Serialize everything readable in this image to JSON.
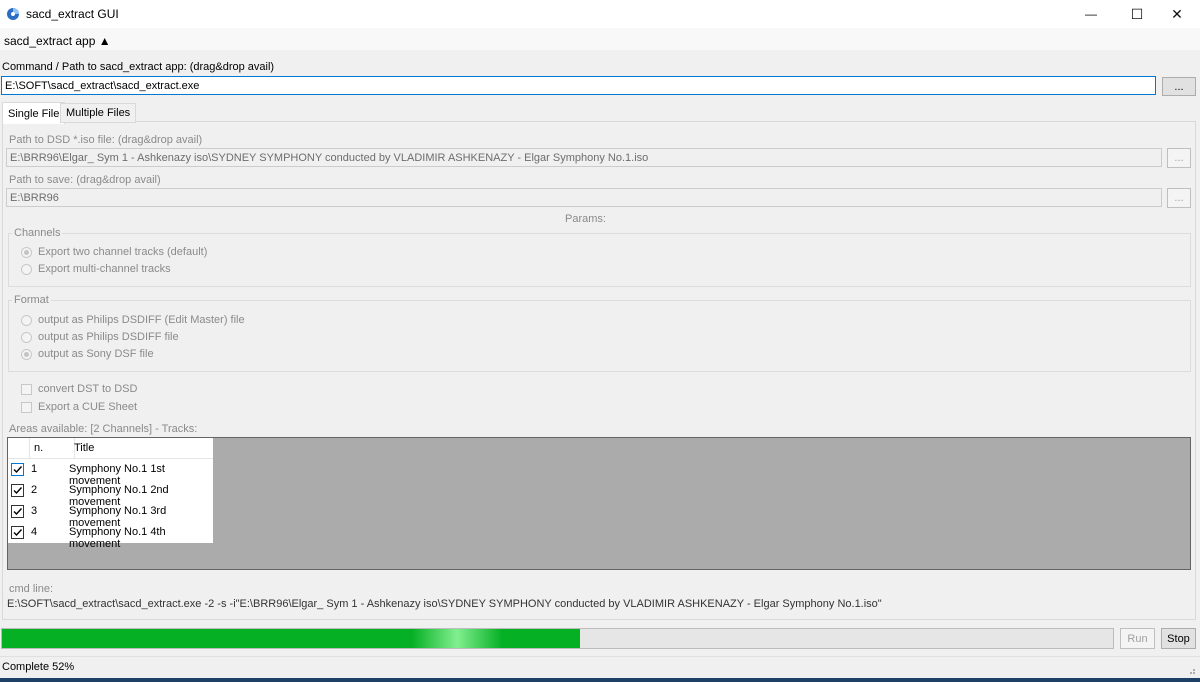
{
  "window": {
    "title": "sacd_extract GUI",
    "minimize_glyph": "—",
    "maximize_glyph": "☐",
    "close_glyph": "✕"
  },
  "menu": {
    "app_title": "sacd_extract app ▲"
  },
  "command": {
    "label": "Command / Path to sacd_extract app: (drag&drop avail)",
    "value": "E:\\SOFT\\sacd_extract\\sacd_extract.exe",
    "browse_label": "..."
  },
  "tabs": [
    {
      "label": "Single File",
      "active": true
    },
    {
      "label": "Multiple Files",
      "active": false
    }
  ],
  "single": {
    "iso_label": "Path to DSD *.iso file: (drag&drop avail)",
    "iso_value": "E:\\BRR96\\Elgar_ Sym 1 - Ashkenazy iso\\SYDNEY SYMPHONY conducted by VLADIMIR ASHKENAZY - Elgar Symphony No.1.iso",
    "iso_browse": "...",
    "save_label": "Path to save: (drag&drop avail)",
    "save_value": "E:\\BRR96",
    "save_browse": "...",
    "params_label": "Params:",
    "channels": {
      "legend": "Channels",
      "options": [
        {
          "label": "Export two channel tracks (default)",
          "checked": true
        },
        {
          "label": "Export multi-channel tracks",
          "checked": false
        }
      ]
    },
    "format": {
      "legend": "Format",
      "options": [
        {
          "label": "output as Philips DSDIFF (Edit Master) file",
          "checked": false
        },
        {
          "label": "output as Philips DSDIFF file",
          "checked": false
        },
        {
          "label": "output as Sony DSF file",
          "checked": true
        }
      ]
    },
    "convert_dst": "convert DST to DSD",
    "export_cue": "Export a CUE Sheet",
    "areas_label": "Areas available: [2 Channels] - Tracks:",
    "track_columns": {
      "num": "n.",
      "title": "Title"
    },
    "tracks": [
      {
        "n": "1",
        "title": "Symphony No.1 1st movement",
        "checked": true
      },
      {
        "n": "2",
        "title": "Symphony No.1 2nd movement",
        "checked": true
      },
      {
        "n": "3",
        "title": "Symphony No.1 3rd movement",
        "checked": true
      },
      {
        "n": "4",
        "title": "Symphony No.1 4th movement",
        "checked": true
      }
    ],
    "cmd_label": "cmd line:",
    "cmd_value": "E:\\SOFT\\sacd_extract\\sacd_extract.exe -2 -s  -i\"E:\\BRR96\\Elgar_ Sym 1 - Ashkenazy iso\\SYDNEY SYMPHONY conducted by VLADIMIR ASHKENAZY - Elgar Symphony No.1.iso\""
  },
  "progress": {
    "percent": 52
  },
  "buttons": {
    "run": "Run",
    "stop": "Stop"
  },
  "status": {
    "text": "Complete 52%"
  },
  "colors": {
    "progress": "#06b025",
    "focus": "#0078d7",
    "list_bg": "#ababab"
  }
}
